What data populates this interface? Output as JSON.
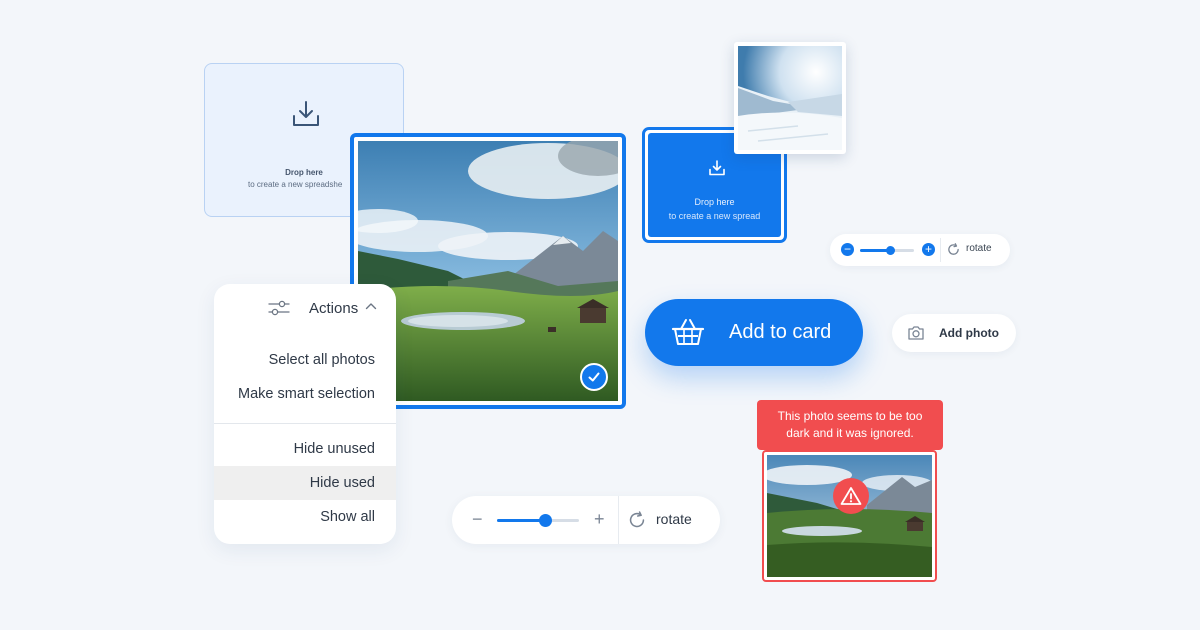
{
  "drop_light": {
    "title": "Drop here",
    "subtitle": "to create a new spreadshe"
  },
  "drop_blue": {
    "title": "Drop here",
    "subtitle": "to create a new spread"
  },
  "main_photo": {
    "selected": true
  },
  "zoom_small": {
    "minus": "−",
    "plus": "+",
    "rotate_label": "rotate",
    "level": 0.55
  },
  "add_to_card": {
    "label": "Add to card"
  },
  "add_photo": {
    "label": "Add photo"
  },
  "actions_menu": {
    "title": "Actions",
    "items": [
      {
        "label": "Select all photos",
        "selected": false
      },
      {
        "label": "Make smart selection",
        "selected": false
      },
      {
        "label": "Hide unused",
        "selected": false
      },
      {
        "label": "Hide used",
        "selected": true
      },
      {
        "label": "Show all",
        "selected": false
      }
    ]
  },
  "zoom_big": {
    "minus": "−",
    "plus": "+",
    "rotate_label": "rotate",
    "level": 0.58
  },
  "warning": {
    "message_line1": "This photo seems to be too",
    "message_line2": "dark and it was ignored."
  },
  "colors": {
    "accent": "#1278ec",
    "danger": "#f14d4f",
    "background": "#f3f6fa",
    "drop_light_bg": "#eaf2fd"
  },
  "icons": [
    "download-icon",
    "check-icon",
    "basket-icon",
    "camera-icon",
    "filter-icon",
    "chevron-up-icon",
    "rotate-icon",
    "warning-icon"
  ]
}
